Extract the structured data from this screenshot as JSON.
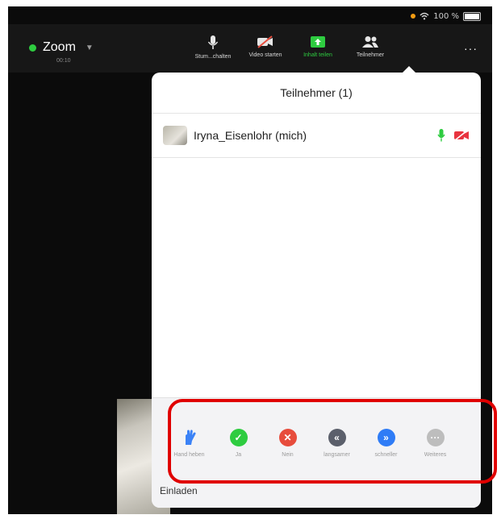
{
  "status": {
    "battery": "100 %"
  },
  "meeting": {
    "title": "Zoom",
    "time": "00:10"
  },
  "toolbar": {
    "items": [
      {
        "label": "Stum...chalten",
        "icon": "microphone-icon"
      },
      {
        "label": "Video starten",
        "icon": "video-off-icon"
      },
      {
        "label": "Inhalt teilen",
        "icon": "share-content-icon",
        "color": "#2ecc40"
      },
      {
        "label": "Teilnehmer",
        "icon": "participants-icon"
      }
    ],
    "more_label": "···"
  },
  "panel": {
    "title": "Teilnehmer (1)",
    "participants": [
      {
        "name": "Iryna_Eisenlohr (mich)",
        "mic_icon": "microphone-on-icon",
        "video_icon": "video-off-icon"
      }
    ]
  },
  "reactions": [
    {
      "label": "Hand heben",
      "icon": "raise-hand-icon",
      "color": "#3b82f6"
    },
    {
      "label": "Ja",
      "icon": "yes-icon",
      "color": "#2ecc40"
    },
    {
      "label": "Nein",
      "icon": "no-icon",
      "color": "#e74c3c"
    },
    {
      "label": "langsamer",
      "icon": "slower-icon",
      "color": "#5b5f6b"
    },
    {
      "label": "schneller",
      "icon": "faster-icon",
      "color": "#2f7cf6"
    },
    {
      "label": "Weiteres",
      "icon": "more-icon",
      "color": "#bdbdbd"
    }
  ],
  "invite_label": "Einladen"
}
